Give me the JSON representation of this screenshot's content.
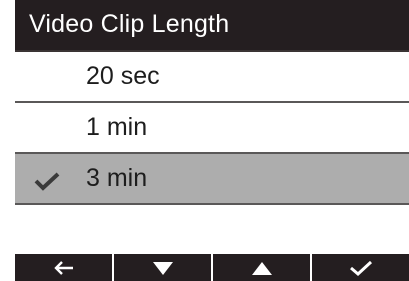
{
  "title": "Video Clip Length",
  "options": [
    {
      "label": "20 sec",
      "selected": false
    },
    {
      "label": "1 min",
      "selected": false
    },
    {
      "label": "3 min",
      "selected": true
    }
  ],
  "softkeys": [
    {
      "icon": "back-arrow-icon"
    },
    {
      "icon": "down-triangle-icon"
    },
    {
      "icon": "up-triangle-icon"
    },
    {
      "icon": "confirm-check-icon"
    }
  ],
  "colors": {
    "title_bar_bg": "#241e20",
    "selected_row_bg": "#adadad",
    "text": "#1d1d1d",
    "title_text": "#ffffff"
  }
}
